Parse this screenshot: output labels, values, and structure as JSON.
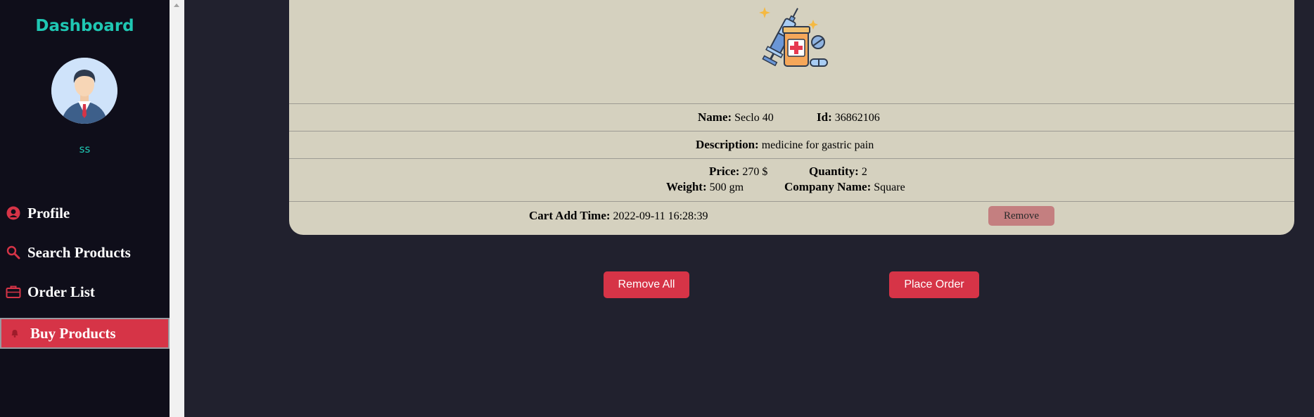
{
  "sidebar": {
    "title": "Dashboard",
    "username": "ss",
    "items": [
      {
        "label": "Profile",
        "icon": "user-circle-icon"
      },
      {
        "label": "Search Products",
        "icon": "search-icon"
      },
      {
        "label": "Order List",
        "icon": "briefcase-icon"
      },
      {
        "label": "Buy Products",
        "icon": "bell-icon",
        "active": true
      }
    ]
  },
  "cart_item": {
    "image": "medicine-syringe-pills-icon",
    "name_label": "Name:",
    "name": "Seclo 40",
    "id_label": "Id:",
    "id": "36862106",
    "description_label": "Description:",
    "description": "medicine for gastric pain",
    "price_label": "Price:",
    "price": "270 $",
    "quantity_label": "Quantity:",
    "quantity": "2",
    "weight_label": "Weight:",
    "weight": "500 gm",
    "company_label": "Company Name:",
    "company": "Square",
    "cart_time_label": "Cart Add Time:",
    "cart_time": "2022-09-11 16:28:39",
    "remove_label": "Remove"
  },
  "actions": {
    "remove_all_label": "Remove All",
    "place_order_label": "Place Order"
  },
  "colors": {
    "sidebar_bg": "#0f0e1a",
    "accent_teal": "#1fc7b3",
    "accent_red": "#d63447",
    "card_bg": "#d5d1bf",
    "main_bg": "#21212e"
  }
}
